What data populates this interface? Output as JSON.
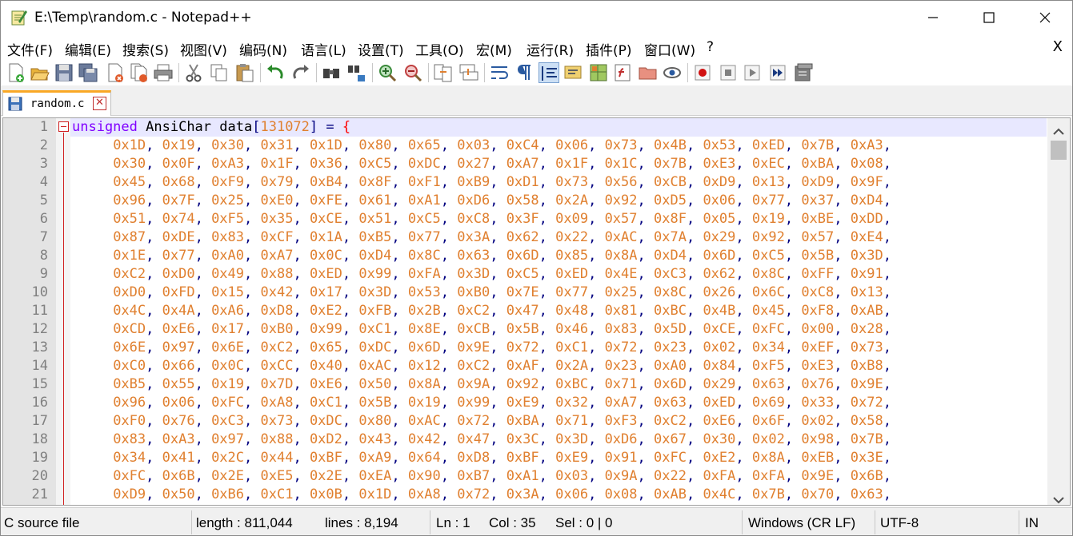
{
  "window": {
    "title": "E:\\Temp\\random.c - Notepad++",
    "minimize_icon": "minimize-icon",
    "maximize_icon": "maximize-icon",
    "close_icon": "close-icon"
  },
  "menu": {
    "items": [
      "文件(F)",
      "编辑(E)",
      "搜索(S)",
      "视图(V)",
      "编码(N)",
      "语言(L)",
      "设置(T)",
      "工具(O)",
      "宏(M)",
      "运行(R)",
      "插件(P)",
      "窗口(W)",
      "?"
    ],
    "close_label": "X"
  },
  "toolbar": {
    "icons": [
      "new-file-icon",
      "open-file-icon",
      "save-icon",
      "save-all-icon",
      "close-icon",
      "close-all-icon",
      "print-icon",
      "cut-icon",
      "copy-icon",
      "paste-icon",
      "undo-icon",
      "redo-icon",
      "find-icon",
      "replace-icon",
      "zoom-in-icon",
      "zoom-out-icon",
      "sync-vertical-icon",
      "sync-horizontal-icon",
      "word-wrap-icon",
      "show-all-chars-icon",
      "indent-guide-icon",
      "language-define-icon",
      "document-map-icon",
      "function-list-icon",
      "folder-workspace-icon",
      "monitoring-icon",
      "record-macro-icon",
      "stop-macro-icon",
      "play-macro-icon",
      "run-macro-multiple-icon",
      "save-macro-icon"
    ]
  },
  "tab": {
    "label": "random.c",
    "close_glyph": "✕"
  },
  "editor": {
    "line_numbers": [
      "1",
      "2",
      "3",
      "4",
      "5",
      "6",
      "7",
      "8",
      "9",
      "10",
      "11",
      "12",
      "13",
      "14",
      "15",
      "16",
      "17",
      "18",
      "19",
      "20",
      "21"
    ],
    "first_line": {
      "keyword": "unsigned",
      "type": "AnsiChar",
      "name": "data",
      "size": "131072",
      "assign": "=",
      "brace": "{"
    },
    "lines": [
      [
        "0x1D",
        "0x19",
        "0x30",
        "0x31",
        "0x1D",
        "0x80",
        "0x65",
        "0x03",
        "0xC4",
        "0x06",
        "0x73",
        "0x4B",
        "0x53",
        "0xED",
        "0x7B",
        "0xA3"
      ],
      [
        "0x30",
        "0x0F",
        "0xA3",
        "0x1F",
        "0x36",
        "0xC5",
        "0xDC",
        "0x27",
        "0xA7",
        "0x1F",
        "0x1C",
        "0x7B",
        "0xE3",
        "0xEC",
        "0xBA",
        "0x08"
      ],
      [
        "0x45",
        "0x68",
        "0xF9",
        "0x79",
        "0xB4",
        "0x8F",
        "0xF1",
        "0xB9",
        "0xD1",
        "0x73",
        "0x56",
        "0xCB",
        "0xD9",
        "0x13",
        "0xD9",
        "0x9F"
      ],
      [
        "0x96",
        "0x7F",
        "0x25",
        "0xE0",
        "0xFE",
        "0x61",
        "0xA1",
        "0xD6",
        "0x58",
        "0x2A",
        "0x92",
        "0xD5",
        "0x06",
        "0x77",
        "0x37",
        "0xD4"
      ],
      [
        "0x51",
        "0x74",
        "0xF5",
        "0x35",
        "0xCE",
        "0x51",
        "0xC5",
        "0xC8",
        "0x3F",
        "0x09",
        "0x57",
        "0x8F",
        "0x05",
        "0x19",
        "0xBE",
        "0xDD"
      ],
      [
        "0x87",
        "0xDE",
        "0x83",
        "0xCF",
        "0x1A",
        "0xB5",
        "0x77",
        "0x3A",
        "0x62",
        "0x22",
        "0xAC",
        "0x7A",
        "0x29",
        "0x92",
        "0x57",
        "0xE4"
      ],
      [
        "0x1E",
        "0x77",
        "0xA0",
        "0xA7",
        "0x0C",
        "0xD4",
        "0x8C",
        "0x63",
        "0x6D",
        "0x85",
        "0x8A",
        "0xD4",
        "0x6D",
        "0xC5",
        "0x5B",
        "0x3D"
      ],
      [
        "0xC2",
        "0xD0",
        "0x49",
        "0x88",
        "0xED",
        "0x99",
        "0xFA",
        "0x3D",
        "0xC5",
        "0xED",
        "0x4E",
        "0xC3",
        "0x62",
        "0x8C",
        "0xFF",
        "0x91"
      ],
      [
        "0xD0",
        "0xFD",
        "0x15",
        "0x42",
        "0x17",
        "0x3D",
        "0x53",
        "0xB0",
        "0x7E",
        "0x77",
        "0x25",
        "0x8C",
        "0x26",
        "0x6C",
        "0xC8",
        "0x13"
      ],
      [
        "0x4C",
        "0x4A",
        "0xA6",
        "0xD8",
        "0xE2",
        "0xFB",
        "0x2B",
        "0xC2",
        "0x47",
        "0x48",
        "0x81",
        "0xBC",
        "0x4B",
        "0x45",
        "0xF8",
        "0xAB"
      ],
      [
        "0xCD",
        "0xE6",
        "0x17",
        "0xB0",
        "0x99",
        "0xC1",
        "0x8E",
        "0xCB",
        "0x5B",
        "0x46",
        "0x83",
        "0x5D",
        "0xCE",
        "0xFC",
        "0x00",
        "0x28"
      ],
      [
        "0x6E",
        "0x97",
        "0x6E",
        "0xC2",
        "0x65",
        "0xDC",
        "0x6D",
        "0x9E",
        "0x72",
        "0xC1",
        "0x72",
        "0x23",
        "0x02",
        "0x34",
        "0xEF",
        "0x73"
      ],
      [
        "0xC0",
        "0x66",
        "0x0C",
        "0xCC",
        "0x40",
        "0xAC",
        "0x12",
        "0xC2",
        "0xAF",
        "0x2A",
        "0x23",
        "0xA0",
        "0x84",
        "0xF5",
        "0xE3",
        "0xB8"
      ],
      [
        "0xB5",
        "0x55",
        "0x19",
        "0x7D",
        "0xE6",
        "0x50",
        "0x8A",
        "0x9A",
        "0x92",
        "0xBC",
        "0x71",
        "0x6D",
        "0x29",
        "0x63",
        "0x76",
        "0x9E"
      ],
      [
        "0x96",
        "0x06",
        "0xFC",
        "0xA8",
        "0xC1",
        "0x5B",
        "0x19",
        "0x99",
        "0xE9",
        "0x32",
        "0xA7",
        "0x63",
        "0xED",
        "0x69",
        "0x33",
        "0x72"
      ],
      [
        "0xF0",
        "0x76",
        "0xC3",
        "0x73",
        "0xDC",
        "0x80",
        "0xAC",
        "0x72",
        "0xBA",
        "0x71",
        "0xF3",
        "0xC2",
        "0xE6",
        "0x6F",
        "0x02",
        "0x58"
      ],
      [
        "0x83",
        "0xA3",
        "0x97",
        "0x88",
        "0xD2",
        "0x43",
        "0x42",
        "0x47",
        "0x3C",
        "0x3D",
        "0xD6",
        "0x67",
        "0x30",
        "0x02",
        "0x98",
        "0x7B"
      ],
      [
        "0x34",
        "0x41",
        "0x2C",
        "0x44",
        "0xBF",
        "0xA9",
        "0x64",
        "0xD8",
        "0xBF",
        "0xE9",
        "0x91",
        "0xFC",
        "0xE2",
        "0x8A",
        "0xEB",
        "0x3E"
      ],
      [
        "0xFC",
        "0x6B",
        "0x2E",
        "0xE5",
        "0x2E",
        "0xEA",
        "0x90",
        "0xB7",
        "0xA1",
        "0x03",
        "0x9A",
        "0x22",
        "0xFA",
        "0xFA",
        "0x9E",
        "0x6B"
      ],
      [
        "0xD9",
        "0x50",
        "0xB6",
        "0xC1",
        "0x0B",
        "0x1D",
        "0xA8",
        "0x72",
        "0x3A",
        "0x06",
        "0x08",
        "0xAB",
        "0x4C",
        "0x7B",
        "0x70",
        "0x63"
      ]
    ]
  },
  "status": {
    "file_type": "C source file",
    "length": "length : 811,044",
    "lines": "lines : 8,194",
    "ln": "Ln : 1",
    "col": "Col : 35",
    "sel": "Sel : 0 | 0",
    "eol": "Windows (CR LF)",
    "encoding": "UTF-8",
    "mode": "IN"
  },
  "colors": {
    "keyword": "#8000ff",
    "number": "#e08030",
    "tab_accent": "#f9a825",
    "current_line": "#e8e8ff"
  }
}
